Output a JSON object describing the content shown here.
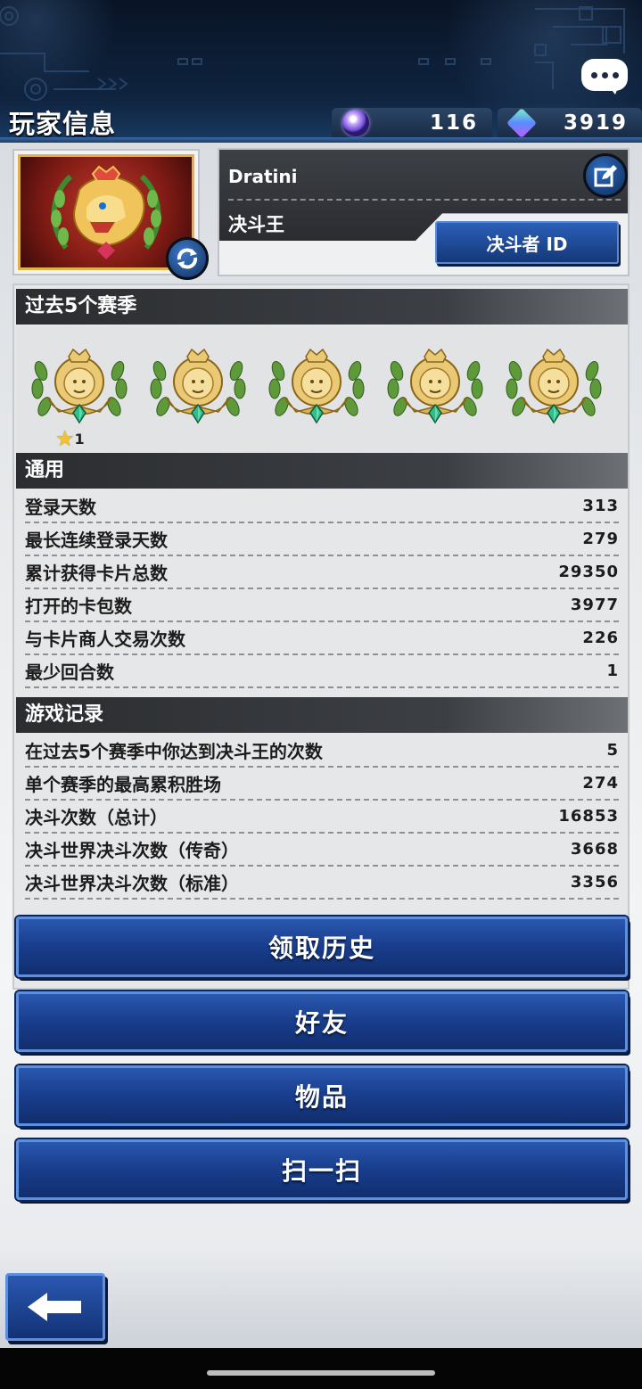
{
  "header": {
    "title": "玩家信息",
    "currencies": [
      {
        "icon": "gem-icon",
        "value": "116"
      },
      {
        "icon": "crystal-icon",
        "value": "3919"
      }
    ]
  },
  "profile": {
    "name": "Dratini",
    "title": "决斗王",
    "duelist_id_label": "决斗者 ID"
  },
  "seasons": {
    "header": "过去5个赛季",
    "medal_count": 5,
    "first_medal_stars": "1"
  },
  "general": {
    "header": "通用",
    "rows": [
      {
        "label": "登录天数",
        "value": "313"
      },
      {
        "label": "最长连续登录天数",
        "value": "279"
      },
      {
        "label": "累计获得卡片总数",
        "value": "29350"
      },
      {
        "label": "打开的卡包数",
        "value": "3977"
      },
      {
        "label": "与卡片商人交易次数",
        "value": "226"
      },
      {
        "label": "最少回合数",
        "value": "1"
      }
    ]
  },
  "records": {
    "header": "游戏记录",
    "rows": [
      {
        "label": "在过去5个赛季中你达到决斗王的次数",
        "value": "5"
      },
      {
        "label": "单个赛季的最高累积胜场",
        "value": "274"
      },
      {
        "label": "决斗次数（总计）",
        "value": "16853"
      },
      {
        "label": "决斗世界决斗次数（传奇）",
        "value": "3668"
      },
      {
        "label": "决斗世界决斗次数（标准）",
        "value": "3356"
      }
    ]
  },
  "menu": {
    "claim_history": "领取历史",
    "friends": "好友",
    "items": "物品",
    "scan": "扫一扫"
  },
  "colors": {
    "button_blue": "#1a3f8f",
    "header_dark": "#0f2440",
    "section_dark": "#2b2d30"
  }
}
